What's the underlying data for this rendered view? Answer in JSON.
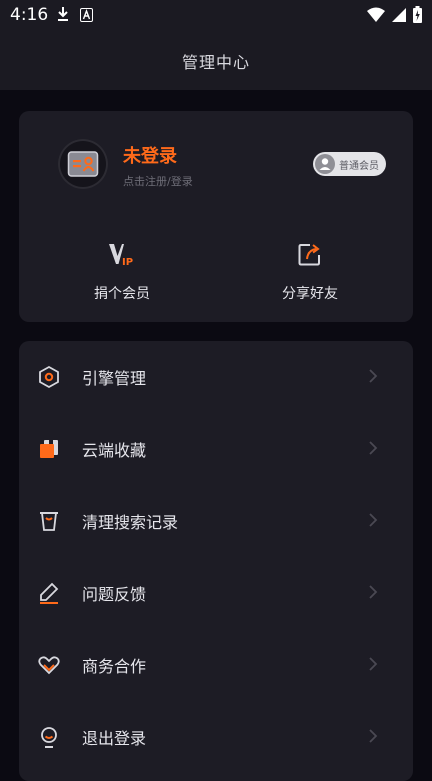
{
  "status_bar": {
    "time": "4:16"
  },
  "header": {
    "title": "管理中心"
  },
  "profile": {
    "name": "未登录",
    "hint": "点击注册/登录",
    "badge": "普通会员"
  },
  "actions": [
    {
      "label": "捐个会员",
      "icon": "vip-icon"
    },
    {
      "label": "分享好友",
      "icon": "share-icon"
    }
  ],
  "menu": [
    {
      "label": "引擎管理",
      "icon": "engine-hexagon-icon"
    },
    {
      "label": "云端收藏",
      "icon": "cloud-bookmark-icon"
    },
    {
      "label": "清理搜索记录",
      "icon": "trash-icon"
    },
    {
      "label": "问题反馈",
      "icon": "pencil-icon"
    },
    {
      "label": "商务合作",
      "icon": "handshake-heart-icon"
    },
    {
      "label": "退出登录",
      "icon": "logout-user-icon"
    }
  ],
  "colors": {
    "accent": "#ff6a1a",
    "card": "#1d1c25",
    "background": "#0b0a12"
  }
}
